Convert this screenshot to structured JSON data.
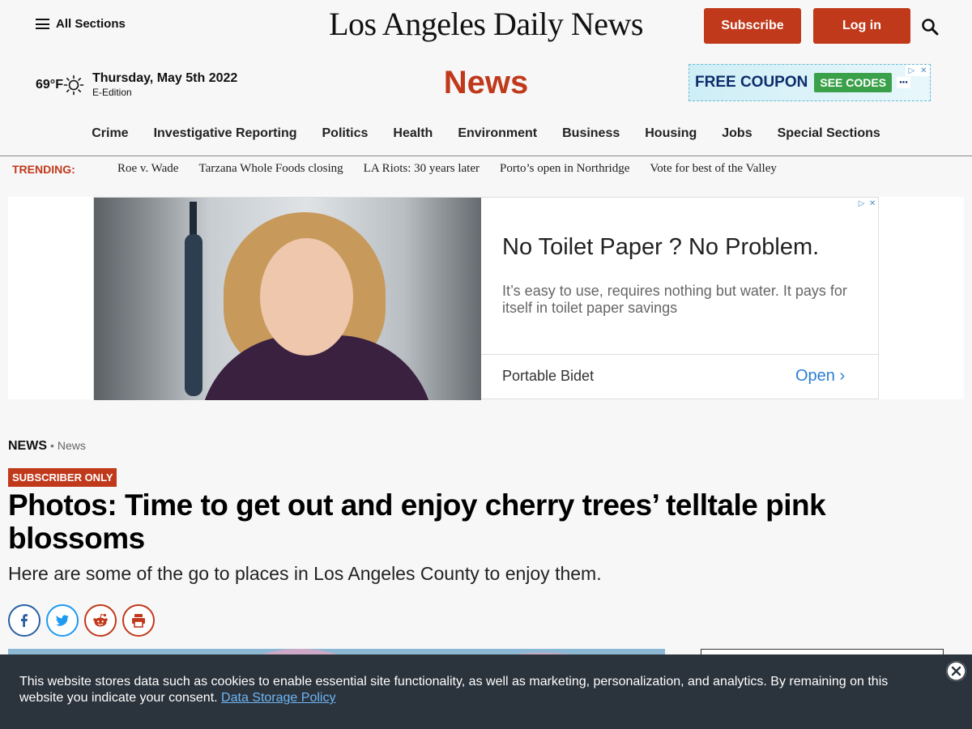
{
  "header": {
    "sections_label": "All Sections",
    "masthead": "Los Angeles Daily News",
    "subscribe_label": "Subscribe",
    "login_label": "Log in",
    "search_icon": "search-icon"
  },
  "weather": {
    "temp": "69°F",
    "icon": "sun-icon",
    "date": "Thursday, May 5th 2022",
    "edition": "E-Edition"
  },
  "section_title": "News",
  "coupon_ad": {
    "text": "FREE COUPON",
    "cta": "SEE CODES"
  },
  "nav": {
    "items": [
      "Crime",
      "Investigative Reporting",
      "Politics",
      "Health",
      "Environment",
      "Business",
      "Housing",
      "Jobs",
      "Special Sections"
    ]
  },
  "trending": {
    "label": "TRENDING:",
    "items": [
      "Roe v. Wade",
      "Tarzana Whole Foods closing",
      "LA Riots: 30 years later",
      "Porto’s open in Northridge",
      "Vote for best of the Valley"
    ]
  },
  "ad": {
    "headline": "No Toilet Paper ? No Problem.",
    "body": "It’s easy to use, requires nothing but water. It pays for itself in toilet paper savings",
    "brand": "Portable Bidet",
    "cta": "Open"
  },
  "article": {
    "crumb_main": "NEWS",
    "crumb_sep": "•",
    "crumb_sub": "News",
    "badge": "SUBSCRIBER ONLY",
    "headline": "Photos: Time to get out and enjoy cherry trees’ telltale pink blossoms",
    "subhead": "Here are some of the go to places in Los Angeles County to enjoy them."
  },
  "share": [
    "facebook-icon",
    "twitter-icon",
    "reddit-icon",
    "print-icon"
  ],
  "cookie": {
    "text": "This website stores data such as cookies to enable essential site functionality, as well as marketing, personalization, and analytics. By remaining on this website you indicate your consent.",
    "link": "Data Storage Policy"
  },
  "colors": {
    "brand_red": "#c0391b",
    "cookie_bg": "#2b333c",
    "link_blue": "#2a7fd4"
  }
}
